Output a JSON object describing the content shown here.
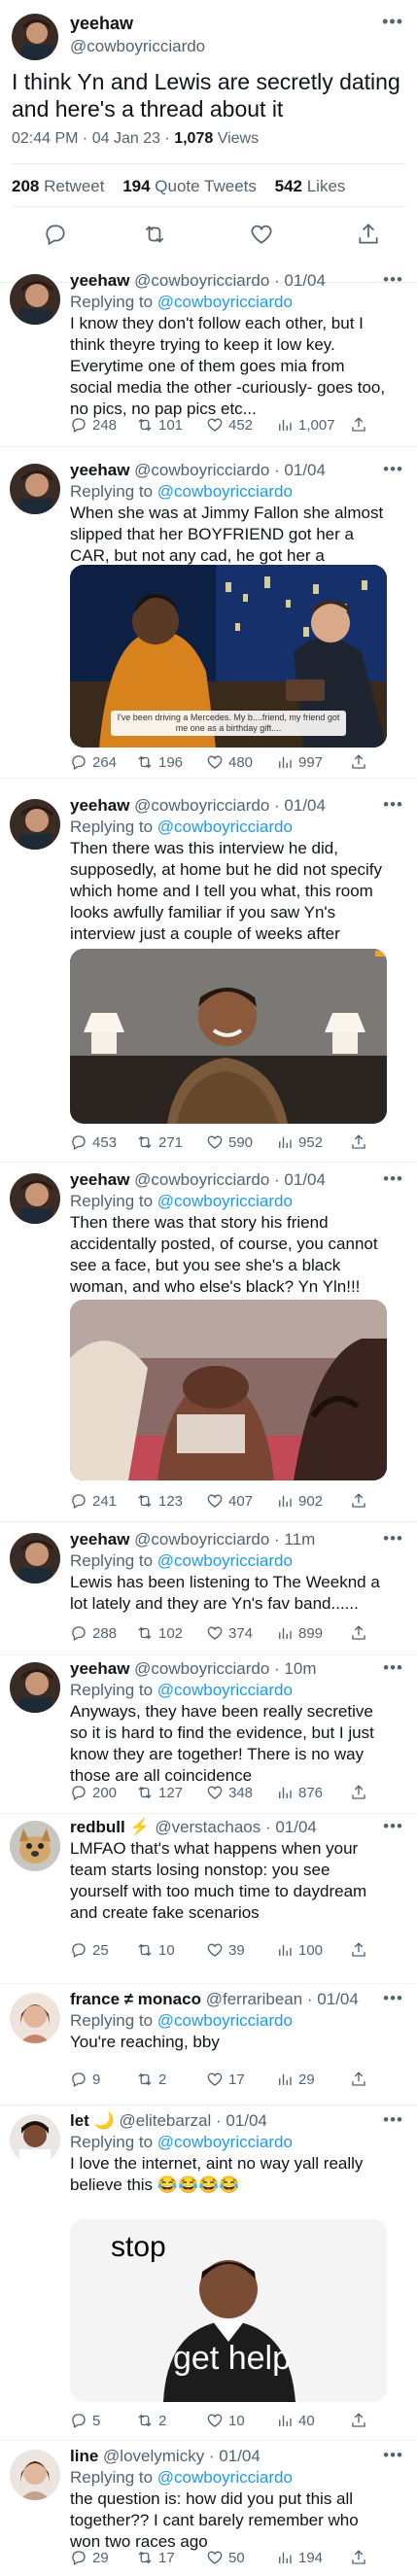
{
  "main": {
    "name": "yeehaw",
    "handle": "@cowboyricciardo",
    "text": "I think Yn and Lewis are secretly dating and here's a thread about it",
    "time": "02:44 PM · 04 Jan 23 · ",
    "views_count": "1,078",
    "views_label": " Views",
    "retweets_count": "208",
    "retweets_label": " Retweet",
    "quotes_count": "194",
    "quotes_label": " Quote Tweets",
    "likes_count": "542",
    "likes_label": " Likes"
  },
  "icons": {
    "reply": "reply-icon",
    "retweet": "retweet-icon",
    "like": "heart-icon",
    "views": "views-icon",
    "share": "share-icon",
    "more": "more-icon"
  },
  "replies": [
    {
      "name": "yeehaw",
      "handle": "@cowboyricciardo · 01/04",
      "replying_prefix": "Replying to ",
      "replying_to": "@cowboyricciardo",
      "text": "I know they don't follow each other, but I think theyre trying to keep it low key. Everytime one of them goes mia from social media the other -curiously- goes too, no pics, no pap pics etc...",
      "replies": "248",
      "retweets": "101",
      "likes": "452",
      "views": "1,007"
    },
    {
      "name": "yeehaw",
      "handle": "@cowboyricciardo · 01/04",
      "replying_prefix": "Replying to ",
      "replying_to": "@cowboyricciardo",
      "text": "When she was at Jimmy Fallon she almost slipped that her BOYFRIEND got her a CAR, but not any cad, he got her a MERCEDES",
      "image_caption": "I've been driving a Mercedes. My b....friend, my friend got me one as a birthday gift....",
      "replies": "264",
      "retweets": "196",
      "likes": "480",
      "views": "997"
    },
    {
      "name": "yeehaw",
      "handle": "@cowboyricciardo · 01/04",
      "replying_prefix": "Replying to ",
      "replying_to": "@cowboyricciardo",
      "text": "Then there was this interview he did, supposedly, at home but he did not specify which home and I tell you what, this room looks awfully familiar if you saw Yn's interview just a couple of weeks after",
      "replies": "453",
      "retweets": "271",
      "likes": "590",
      "views": "952"
    },
    {
      "name": "yeehaw",
      "handle": "@cowboyricciardo · 01/04",
      "replying_prefix": "Replying to ",
      "replying_to": "@cowboyricciardo",
      "text": "Then there was that story his friend accidentally posted, of course, you cannot see a face, but you see she's a black woman, and who else's black? Yn Yln!!!",
      "replies": "241",
      "retweets": "123",
      "likes": "407",
      "views": "902"
    },
    {
      "name": "yeehaw",
      "handle": "@cowboyricciardo · 11m",
      "replying_prefix": "Replying to ",
      "replying_to": "@cowboyricciardo",
      "text": "Lewis has been listening to The Weeknd a lot lately and they are Yn's fav band......",
      "replies": "288",
      "retweets": "102",
      "likes": "374",
      "views": "899"
    },
    {
      "name": "yeehaw",
      "handle": "@cowboyricciardo · 10m",
      "replying_prefix": "Replying to ",
      "replying_to": "@cowboyricciardo",
      "text": "Anyways, they have been really secretive so it is hard to find the evidence, but I just know they are together! There is no way those are all coincidence",
      "replies": "200",
      "retweets": "127",
      "likes": "348",
      "views": "876"
    },
    {
      "name": "redbull",
      "name_emoji": "⚡",
      "handle": "@verstachaos · 01/04",
      "replying_prefix": "",
      "replying_to": "",
      "text": "LMFAO that's what happens when your team starts losing nonstop: you see yourself with too much time to daydream and create fake scenarios",
      "replies": "25",
      "retweets": "10",
      "likes": "39",
      "views": "100"
    },
    {
      "name": "france ≠ monaco",
      "handle": "@ferraribean · 01/04",
      "replying_prefix": "Replying to ",
      "replying_to": "@cowboyricciardo",
      "text": "You're reaching, bby",
      "replies": "9",
      "retweets": "2",
      "likes": "17",
      "views": "29"
    },
    {
      "name": "let",
      "name_emoji": "🌙",
      "handle": "@elitebarzal · 01/04",
      "replying_prefix": "Replying to ",
      "replying_to": "@cowboyricciardo",
      "text": "I love the internet, aint no way yall really believe this 😂😂😂😂",
      "image_top_text": "stop",
      "image_bottom_text": "get help",
      "replies": "5",
      "retweets": "2",
      "likes": "10",
      "views": "40"
    },
    {
      "name": "line",
      "handle": "@lovelymicky · 01/04",
      "replying_prefix": "Replying to ",
      "replying_to": "@cowboyricciardo",
      "text": "the question is: how did you put this all together?? I cant barely remember who won two races ago",
      "replies": "29",
      "retweets": "17",
      "likes": "50",
      "views": "194"
    }
  ]
}
